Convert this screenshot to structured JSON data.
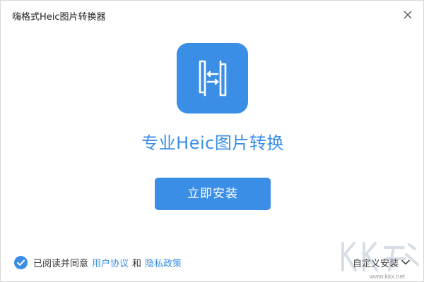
{
  "window": {
    "title": "嗨格式Heic图片转换器",
    "close_icon": "close-icon"
  },
  "logo": {
    "icon": "heic-converter-logo",
    "color": "#3a8ee6"
  },
  "headline": "专业Heic图片转换",
  "install_button": {
    "label": "立即安装",
    "color": "#3a8ee6"
  },
  "agreement": {
    "checked": true,
    "prefix": "已阅读并同意",
    "user_agreement": "用户协议",
    "and": "和",
    "privacy_policy": "隐私政策"
  },
  "custom_install": {
    "label": "自定义安装",
    "icon": "chevron-down-icon"
  },
  "watermark": {
    "url": "www.kkx.net"
  }
}
